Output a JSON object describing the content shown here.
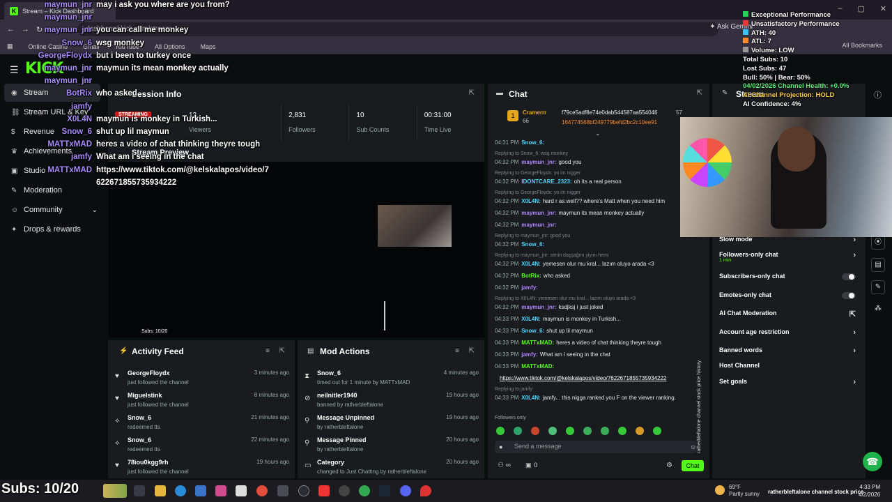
{
  "browser": {
    "tab_title": "Stream – Kick Dashboard",
    "address": "dashboard.kick.com/stream",
    "ask_gemini": "Ask Gemini",
    "bookmarks": [
      "Online Casino",
      "Gmail",
      "YouTube",
      "All Options",
      "Maps"
    ],
    "all_bookmarks": "All Bookmarks"
  },
  "brand": "KICK",
  "sidebar": {
    "items": [
      {
        "label": "Stream",
        "icon": "broadcast-icon"
      },
      {
        "label": "Stream URL & Key",
        "icon": "link-icon"
      },
      {
        "label": "Revenue",
        "icon": "dollar-icon"
      },
      {
        "label": "Achievements",
        "icon": "trophy-icon"
      },
      {
        "label": "Studio",
        "icon": "studio-icon"
      },
      {
        "label": "Moderation",
        "icon": "wrench-icon"
      },
      {
        "label": "Community",
        "icon": "users-icon"
      },
      {
        "label": "Drops & rewards",
        "icon": "gift-icon"
      }
    ]
  },
  "session": {
    "title": "Session Info",
    "badge": "STREAMING",
    "stats": [
      {
        "value": "12",
        "label": "Viewers"
      },
      {
        "value": "2,831",
        "label": "Followers"
      },
      {
        "value": "10",
        "label": "Sub Counts"
      },
      {
        "value": "00:31:00",
        "label": "Time Live"
      }
    ],
    "preview_title": "Stream Preview",
    "preview_subs": "Subs: 10/20"
  },
  "activity": {
    "title": "Activity Feed",
    "rows": [
      {
        "name": "GeorgeFloydx",
        "action": "just followed the channel",
        "time": "3 minutes ago",
        "icon": "heart-icon"
      },
      {
        "name": "Miguelstink",
        "action": "just followed the channel",
        "time": "8 minutes ago",
        "icon": "heart-icon"
      },
      {
        "name": "Snow_6",
        "action": "redeemed tts",
        "time": "21 minutes ago",
        "icon": "reward-icon"
      },
      {
        "name": "Snow_6",
        "action": "redeemed tts",
        "time": "22 minutes ago",
        "icon": "reward-icon"
      },
      {
        "name": "78iou0kgg9rh",
        "action": "just followed the channel",
        "time": "19 hours ago",
        "icon": "heart-icon"
      }
    ]
  },
  "mod_actions": {
    "title": "Mod Actions",
    "rows": [
      {
        "name": "Snow_6",
        "action": "timed out for 1 minute by MATTxMAD",
        "time": "4 minutes ago",
        "icon": "hourglass-icon"
      },
      {
        "name": "neilnitler1940",
        "action": "banned by ratherbleftalone",
        "time": "19 hours ago",
        "icon": "ban-icon"
      },
      {
        "name": "Message Unpinned",
        "action": "by ratherbleftalone",
        "time": "19 hours ago",
        "icon": "unpin-icon"
      },
      {
        "name": "Message Pinned",
        "action": "by ratherbleftalone",
        "time": "20 hours ago",
        "icon": "pin-icon"
      },
      {
        "name": "Category",
        "action": "changed to Just Chatting by ratherbleftalone",
        "time": "20 hours ago",
        "icon": "category-icon"
      }
    ]
  },
  "chat": {
    "title": "Chat",
    "pinned_user": "Cramerrr",
    "pinned_count": "66",
    "pinned_hash1": "f79ce5adf8e74e0dab544587aa554046",
    "pinned_hash2": "164774568bf249779befd2bc2c10ee91",
    "pinned_num": "57",
    "lines": [
      {
        "time": "04:31 PM",
        "user": "Snow_6:",
        "msg": "",
        "color": "#4bd6ff",
        "reply": ""
      },
      {
        "time": "04:32 PM",
        "user": "maymun_jnr:",
        "msg": "good you",
        "color": "#b085ff",
        "reply": "Replying to Snow_6: wsg monkey"
      },
      {
        "time": "04:32 PM",
        "user": "IDONTCARE_2323:",
        "msg": "oh its a real person",
        "color": "#4bd6ff",
        "reply": "Replying to GeorgeFloydx: yo im nigger"
      },
      {
        "time": "04:32 PM",
        "user": "X0L4N:",
        "msg": "hard r as well?? where's Matt when you need him",
        "color": "#4bd6ff",
        "reply": "Replying to GeorgeFloydx: yo im nigger"
      },
      {
        "time": "04:32 PM",
        "user": "maymun_jnr:",
        "msg": "maymun its mean monkey actually",
        "color": "#b085ff",
        "reply": ""
      },
      {
        "time": "04:32 PM",
        "user": "maymun_jnr:",
        "msg": "",
        "color": "#b085ff",
        "reply": ""
      },
      {
        "time": "04:32 PM",
        "user": "Snow_6:",
        "msg": "",
        "color": "#4bd6ff",
        "reply": "Replying to maymun_jnr: good you"
      },
      {
        "time": "04:32 PM",
        "user": "X0L4N:",
        "msg": "yemesen olur mu kral... lazım oluyo arada <3",
        "color": "#4bd6ff",
        "reply": "Replying to maymun_jnr: senin daşşağını yiyim hemi"
      },
      {
        "time": "04:32 PM",
        "user": "BotRix:",
        "msg": "who asked",
        "color": "#53fc18",
        "reply": ""
      },
      {
        "time": "04:32 PM",
        "user": "jamfy:",
        "msg": "",
        "color": "#b085ff",
        "reply": ""
      },
      {
        "time": "04:32 PM",
        "user": "maymun_jnr:",
        "msg": "ksdjksj i just joked",
        "color": "#b085ff",
        "reply": "Replying to X0L4N: yemesen olur mu kral... lazım oluyo arada <3"
      },
      {
        "time": "04:33 PM",
        "user": "X0L4N:",
        "msg": "maymun is monkey in Turkish...",
        "color": "#4bd6ff",
        "reply": ""
      },
      {
        "time": "04:33 PM",
        "user": "Snow_6:",
        "msg": "shut up lil maymun",
        "color": "#4bd6ff",
        "reply": ""
      },
      {
        "time": "04:33 PM",
        "user": "MATTxMAD:",
        "msg": "heres a video of chat thinking theyre tough",
        "color": "#53fc18",
        "reply": ""
      },
      {
        "time": "04:33 PM",
        "user": "jamfy:",
        "msg": "What am i seeing in the chat",
        "color": "#b085ff",
        "reply": ""
      },
      {
        "time": "04:33 PM",
        "user": "MATTxMAD:",
        "msg": "",
        "color": "#53fc18",
        "reply": ""
      },
      {
        "time": "",
        "user": "",
        "msg": "https://www.tiktok.com/@kelskalapos/video/7622671855735934222",
        "color": "#ffffff",
        "reply": ""
      },
      {
        "time": "04:33 PM",
        "user": "X0L4N:",
        "msg": "jamfy... this nigga ranked you F on the viewer ranking.",
        "color": "#4bd6ff",
        "reply": "Replying to jamfy:"
      }
    ],
    "followers_only": "Followers only",
    "placeholder": "Send a message",
    "count": "0",
    "send": "Chat"
  },
  "settings": {
    "title": "Stream",
    "rows": [
      {
        "label": "Slow mode",
        "type": "arrow",
        "sub": ""
      },
      {
        "label": "Followers-only chat",
        "type": "arrow",
        "sub": "1 min"
      },
      {
        "label": "Subscribers-only chat",
        "type": "toggle",
        "sub": ""
      },
      {
        "label": "Emotes-only chat",
        "type": "toggle",
        "sub": ""
      },
      {
        "label": "AI Chat Moderation",
        "type": "external",
        "sub": ""
      },
      {
        "label": "Account age restriction",
        "type": "arrow",
        "sub": ""
      },
      {
        "label": "Banned words",
        "type": "arrow",
        "sub": ""
      },
      {
        "label": "Host Channel",
        "type": "none",
        "sub": ""
      },
      {
        "label": "Set goals",
        "type": "arrow",
        "sub": ""
      }
    ]
  },
  "overlay_stats": {
    "lines": [
      "Exceptional Performance",
      "Unsatisfactory Performance",
      "ATH: 40",
      "ATL: 7",
      "Volume: LOW",
      "Total Subs: 10",
      "Lost Subs: 47",
      "Bull: 50% | Bear: 50%",
      "04/02/2026 Channel Health: +0.0%",
      "AI Channel Projection: HOLD",
      "AI Confidence: 4%"
    ]
  },
  "overlay_chat": [
    {
      "user": "maymun_jnr",
      "msg": "may i ask you where are you from?"
    },
    {
      "user": "maymun_jnr",
      "msg": ""
    },
    {
      "user": "maymun_jnr",
      "msg": "you can call me monkey"
    },
    {
      "user": "Snow_6",
      "msg": "wsg monkey"
    },
    {
      "user": "GeorgeFloydx",
      "msg": "but i been to turkey once"
    },
    {
      "user": "maymun_jnr",
      "msg": "maymun its mean monkey actually"
    },
    {
      "user": "maymun_jnr",
      "msg": ""
    },
    {
      "user": "BotRix",
      "msg": "who asked"
    },
    {
      "user": "jamfy",
      "msg": ""
    },
    {
      "user": "X0L4N",
      "msg": "maymun is monkey in Turkish..."
    },
    {
      "user": "Snow_6",
      "msg": "shut up lil maymun"
    },
    {
      "user": "MATTxMAD",
      "msg": "heres a video of chat thinking theyre tough"
    },
    {
      "user": "jamfy",
      "msg": "What am i seeing in the chat"
    },
    {
      "user": "MATTxMAD",
      "msg": "https://www.tiktok.com/@kelskalapos/video/7"
    },
    {
      "user": "",
      "msg": "622671855735934222"
    }
  ],
  "taskbar": {
    "subs": "Subs: 10/20",
    "weather_temp": "69°F",
    "weather_desc": "Partly sunny",
    "ticker": "ratherbleftalone channel stock price",
    "time": "4:33 PM",
    "date": "4/2/2026"
  },
  "vertical_ticker": "ratherbleftalone channel stock price history"
}
